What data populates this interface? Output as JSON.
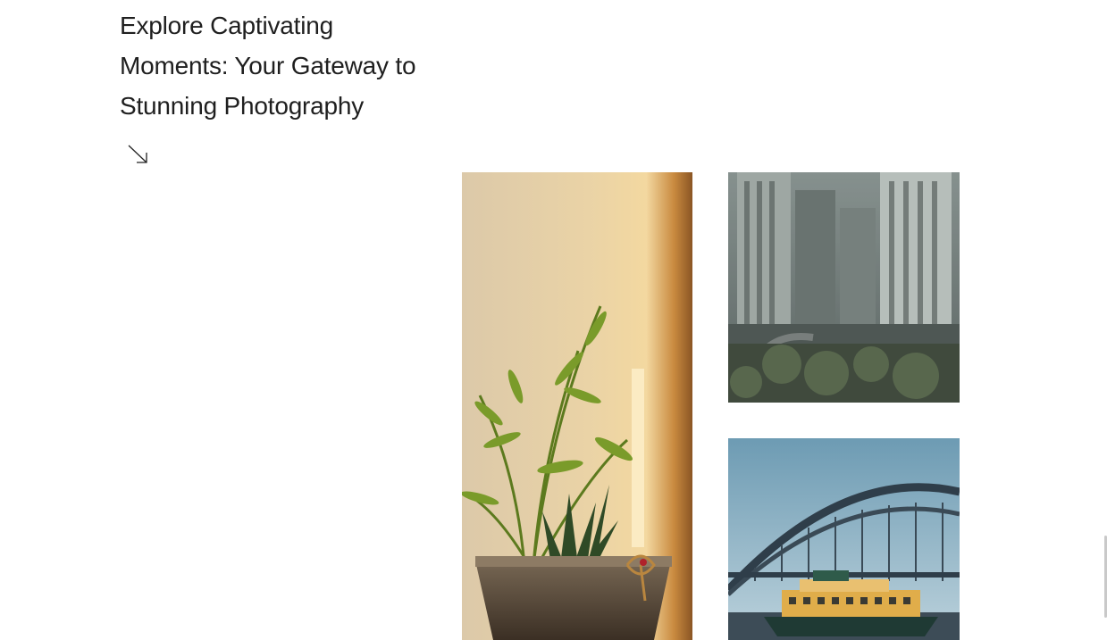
{
  "hero": {
    "title": "Explore Captivating Moments: Your Gateway to Stunning Photography",
    "arrow_icon": "arrow-down-right-icon"
  },
  "gallery": {
    "photos": [
      {
        "subject": "potted palm plant by window",
        "icon": "photo-plant"
      },
      {
        "subject": "rainy city skyline through window",
        "icon": "photo-city"
      },
      {
        "subject": "harbour bridge with ferry",
        "icon": "photo-bridge"
      }
    ]
  },
  "colors": {
    "text": "#1f1f1f",
    "background": "#ffffff"
  }
}
